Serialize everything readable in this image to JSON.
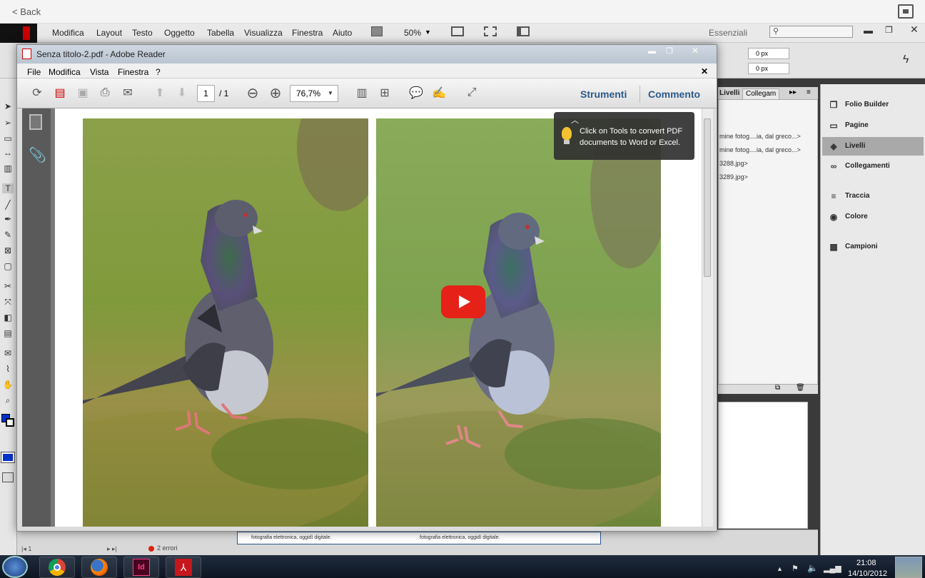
{
  "player": {
    "back_label": "< Back"
  },
  "indesign": {
    "menu": [
      "Modifica",
      "Layout",
      "Testo",
      "Oggetto",
      "Tabella",
      "Visualizza",
      "Finestra",
      "Aiuto"
    ],
    "zoom": "50%",
    "workspace": "Essenziali",
    "offset_x": "0 px",
    "offset_y": "0 px",
    "panel_tabs": [
      "Livelli",
      "Collegam"
    ],
    "links": [
      "mine fotog....ia, dal greco...>",
      "mine fotog....ia, dal greco...>",
      "3288.jpg>",
      "3289.jpg>"
    ],
    "right_panels": [
      "Folio Builder",
      "Pagine",
      "Livelli",
      "Collegamenti",
      "Traccia",
      "Colore",
      "Campioni"
    ],
    "status_errors": "2 errori",
    "text_fragment_1": "fotografia elettronica, oggidì digitale.",
    "text_fragment_2": "fotografia elettronica, oggidì digitale."
  },
  "reader": {
    "title": "Senza titolo-2.pdf - Adobe Reader",
    "menu": [
      "File",
      "Modifica",
      "Vista",
      "Finestra",
      "?"
    ],
    "page_current": "1",
    "page_total": "/ 1",
    "zoom": "76,7%",
    "tools_label": "Strumenti",
    "comment_label": "Commento",
    "tip_text_line1": "Click on Tools to convert PDF",
    "tip_text_line2": "documents to Word or Excel."
  },
  "taskbar": {
    "time": "21:08",
    "date": "14/10/2012",
    "apps": [
      "start-orb",
      "chrome",
      "firefox",
      "indesign",
      "acrobat-reader"
    ]
  },
  "colors": {
    "play_button": "#e62117",
    "reader_accent": "#2b5a8a",
    "indesign": "#49021f"
  }
}
